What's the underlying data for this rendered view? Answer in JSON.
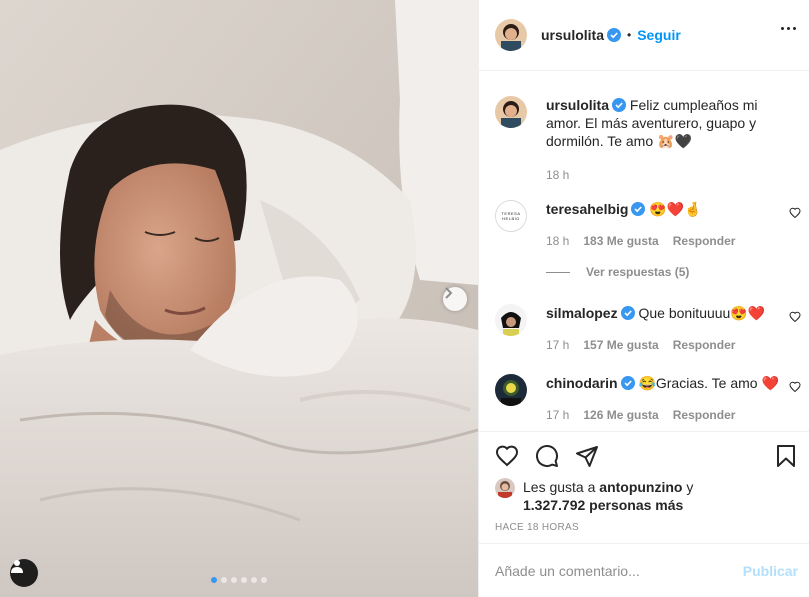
{
  "post": {
    "nav_next_icon": "chevron-right-icon",
    "user_tag_icon": "person-icon",
    "carousel": {
      "count": 6,
      "active_index": 0
    }
  },
  "header": {
    "username": "ursulolita",
    "separator": "•",
    "follow_label": "Seguir",
    "more_icon": "ellipsis-icon"
  },
  "caption": {
    "username": "ursulolita",
    "text": "Feliz cumpleaños mi amor. El más aventurero, guapo y dormilón. Te amo 🐹🖤",
    "time": "18 h"
  },
  "comments": [
    {
      "username": "teresahelbig",
      "avatar_text": "TERESA HELBIG",
      "text": "😍❤️🤞",
      "time": "18 h",
      "likes": "183 Me gusta",
      "reply_label": "Responder",
      "verified": true
    },
    {
      "username": "silmalopez",
      "text": "Que bonituuuu😍❤️",
      "time": "17 h",
      "likes": "157 Me gusta",
      "reply_label": "Responder",
      "verified": true
    },
    {
      "username": "chinodarin",
      "text": "😂Gracias. Te amo ❤️",
      "time": "17 h",
      "likes": "126 Me gusta",
      "reply_label": "Responder",
      "verified": true
    }
  ],
  "view_replies": "Ver respuestas (5)",
  "actions": {
    "like_icon": "heart-icon",
    "comment_icon": "comment-icon",
    "share_icon": "paper-plane-icon",
    "save_icon": "bookmark-icon"
  },
  "likes_summary": {
    "prefix": "Les gusta a ",
    "user": "antopunzino",
    "suffix": " y",
    "count_text": "1.327.792 personas más"
  },
  "posted_ago": "HACE 18 HORAS",
  "add_comment": {
    "placeholder": "Añade un comentario...",
    "publish_label": "Publicar"
  },
  "colors": {
    "accent": "#0095f6",
    "verified": "#3897f0",
    "muted": "#8e8e8e",
    "heart": "#ed4956",
    "publish_disabled": "#b2dffc"
  }
}
